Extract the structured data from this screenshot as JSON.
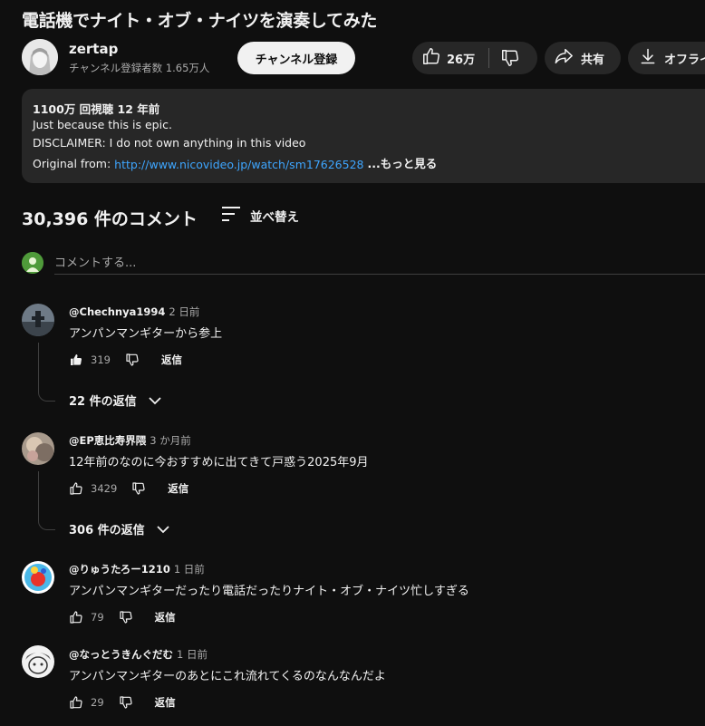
{
  "video": {
    "title": "電話機でナイト・オブ・ナイツを演奏してみた"
  },
  "channel": {
    "name": "zertap",
    "subscribers": "チャンネル登録者数 1.65万人",
    "subscribe_label": "チャンネル登録"
  },
  "actions": {
    "like_count": "26万",
    "share_label": "共有",
    "download_label": "オフライ"
  },
  "description": {
    "views": "1100万 回視聴  12 年前",
    "line1": "Just because this is epic.",
    "line2": "DISCLAIMER: I do not own anything in this video",
    "original_prefix": "Original from: ",
    "link": "http://www.nicovideo.jp/watch/sm17626528",
    "more": "...もっと見る"
  },
  "comments_header": {
    "count": "30,396 件のコメント",
    "sort_label": "並べ替え",
    "add_placeholder": "コメントする..."
  },
  "comments": [
    {
      "author": "@Chechnya1994",
      "time": "2 日前",
      "text": "アンパンマンギターから参上",
      "likes": "319",
      "reply_label": "返信",
      "replies": "22 件の返信"
    },
    {
      "author": "@EP恵比寿界隈",
      "time": "3 か月前",
      "text": "12年前のなのに今おすすめに出てきて戸惑う2025年9月",
      "likes": "3429",
      "reply_label": "返信",
      "replies": "306 件の返信"
    },
    {
      "author": "@りゅうたろー1210",
      "time": "1 日前",
      "text": "アンパンマンギターだったり電話だったりナイト・オブ・ナイツ忙しすぎる",
      "likes": "79",
      "reply_label": "返信"
    },
    {
      "author": "@なっとうきんぐだむ",
      "time": "1 日前",
      "text": "アンパンマンギターのあとにこれ流れてくるのなんなんだよ",
      "likes": "29",
      "reply_label": "返信"
    }
  ],
  "icons": {
    "like": "thumbs-up-icon",
    "dislike": "thumbs-down-icon",
    "share": "share-arrow-icon",
    "download": "download-icon",
    "sort": "sort-lines-icon",
    "chevron": "chevron-down-icon"
  },
  "colors": {
    "background": "#0f0f0f",
    "surface": "#272727",
    "text": "#f1f1f1",
    "muted": "#aaaaaa",
    "link": "#3ea6ff"
  }
}
